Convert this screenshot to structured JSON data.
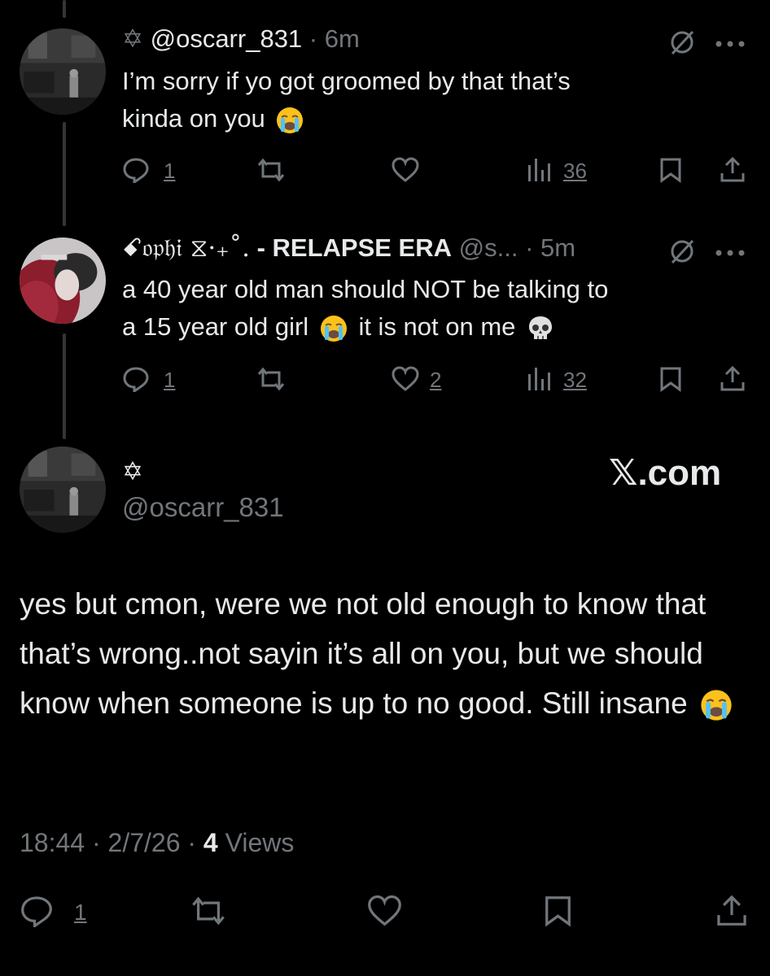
{
  "reply1": {
    "symbol": "✡",
    "handle": "@oscarr_831",
    "sep": " · ",
    "time": "6m",
    "text_line1": "I’m sorry if yo got groomed by that that’s",
    "text_line2": "kinda on you",
    "emoji": "loudly-crying-face",
    "replies": "1",
    "views": "36"
  },
  "reply2": {
    "display_name": "ꗃ𝔬𝔭𝔥𝔦 ⧖·₊˚.",
    "display_name_bold": "- RELAPSE ERA",
    "handle": "@s...",
    "sep": " · ",
    "time": "5m",
    "text_line1": "a 40 year old man should NOT be talking to",
    "text_line2_a": "a 15 year old girl",
    "text_line2_b": "it is not on me",
    "emoji1": "loudly-crying-face",
    "emoji2": "skull",
    "replies": "1",
    "likes": "2",
    "views": "32"
  },
  "main_post": {
    "symbol": "✡",
    "handle": "@oscarr_831",
    "watermark": "𝕏.com",
    "text": "yes but cmon, were we not old enough to know that that’s wrong..not sayin it’s all on you, but we should know when someone is up to no good. Still insane",
    "emoji": "loudly-crying-face",
    "time": "18:44",
    "date": "2/7/26",
    "views_count": "4",
    "views_label": "Views",
    "replies": "1"
  },
  "colors": {
    "background": "#000000",
    "text": "#e7e9ea",
    "muted": "#71767b",
    "line": "#333639"
  }
}
